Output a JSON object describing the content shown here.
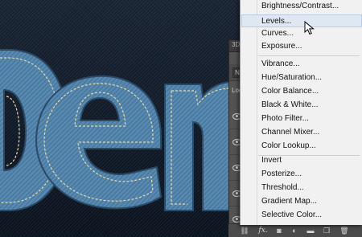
{
  "canvas": {
    "text_fragment": "Dem",
    "fill_color": "#4d7fa6",
    "stitch_color": "#e7d9a8",
    "background_color": "#141f2e"
  },
  "layers_panel": {
    "tab_label": "3D",
    "filter_kind_label": "N",
    "lock_label": "Loc"
  },
  "adjustment_menu": {
    "items": [
      {
        "label": "Brightness/Contrast...",
        "highlighted": false
      },
      {
        "label": "Levels...",
        "highlighted": true
      },
      {
        "label": "Curves...",
        "highlighted": false
      },
      {
        "label": "Exposure...",
        "highlighted": false
      },
      {
        "label": "Vibrance...",
        "highlighted": false
      },
      {
        "label": "Hue/Saturation...",
        "highlighted": false
      },
      {
        "label": "Color Balance...",
        "highlighted": false
      },
      {
        "label": "Black & White...",
        "highlighted": false
      },
      {
        "label": "Photo Filter...",
        "highlighted": false
      },
      {
        "label": "Channel Mixer...",
        "highlighted": false
      },
      {
        "label": "Color Lookup...",
        "highlighted": false
      },
      {
        "label": "Invert",
        "highlighted": false
      },
      {
        "label": "Posterize...",
        "highlighted": false
      },
      {
        "label": "Threshold...",
        "highlighted": false
      },
      {
        "label": "Gradient Map...",
        "highlighted": false
      },
      {
        "label": "Selective Color...",
        "highlighted": false
      }
    ]
  },
  "bottom_bar": {
    "fx_label": "fx."
  },
  "colors": {
    "menu_bg": "#f1f1f1",
    "menu_highlight": "#dfe7f3",
    "panel_bg": "#535353"
  }
}
